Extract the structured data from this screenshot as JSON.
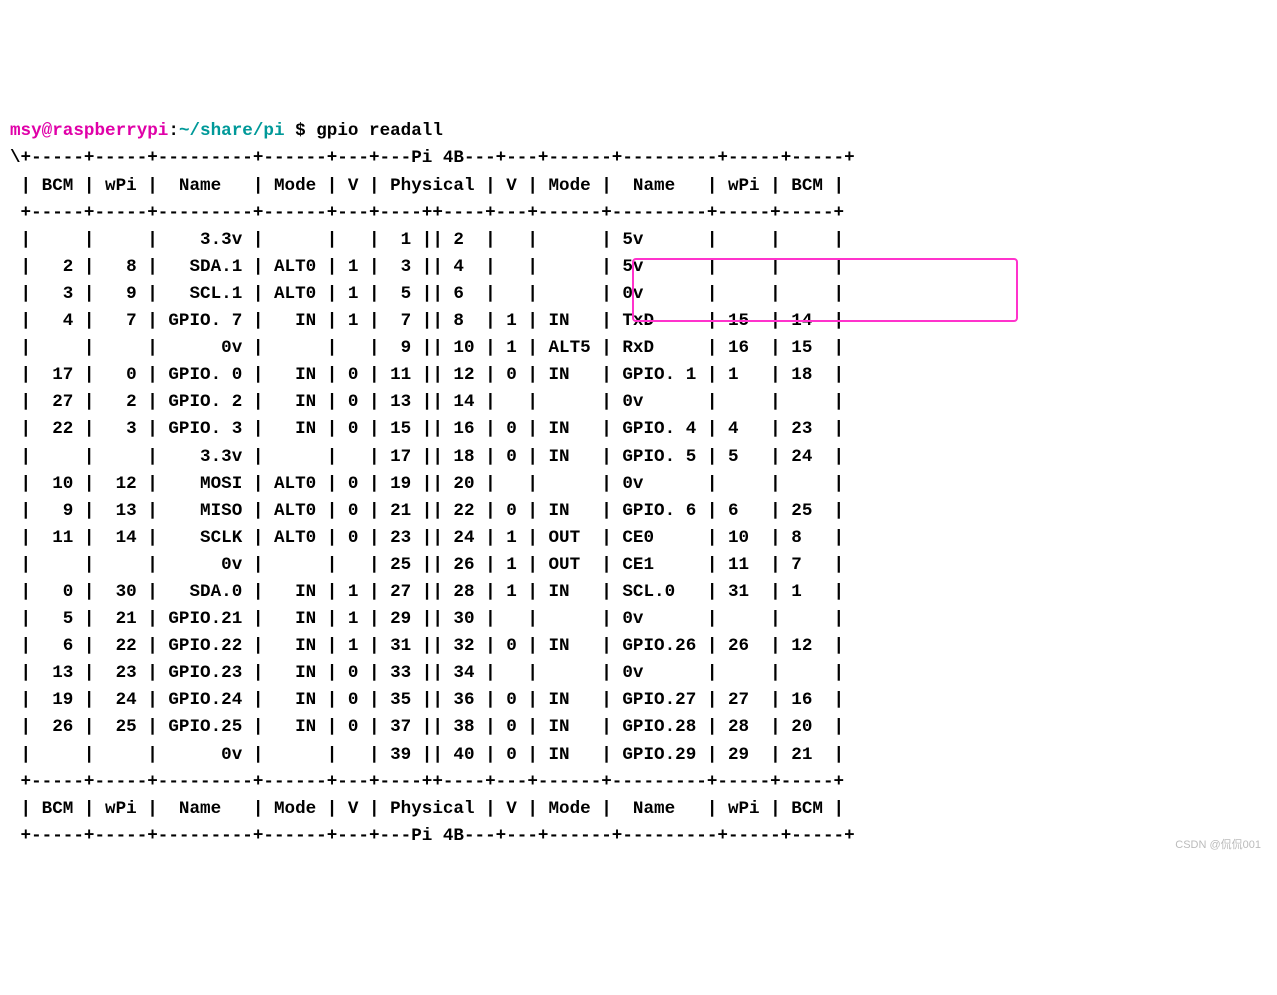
{
  "prompt": {
    "user": "msy@raspberrypi",
    "sep1": ":",
    "path": "~/share/pi",
    "dollar": " $ ",
    "cmd": "gpio readall"
  },
  "board": "Pi 4B",
  "headers": [
    "BCM",
    "wPi",
    "Name",
    "Mode",
    "V",
    "Physical",
    "V",
    "Mode",
    "Name",
    "wPi",
    "BCM"
  ],
  "hr_left": " +-----+-----+---------+------+---+---",
  "hr_right": "---+---+------+---------+-----+-----+",
  "rows": [
    {
      "l": {
        "bcm": "",
        "wpi": "",
        "name": "3.3v",
        "mode": "",
        "v": ""
      },
      "pl": "1",
      "pr": "2",
      "r": {
        "v": "",
        "mode": "",
        "name": "5v",
        "wpi": "",
        "bcm": ""
      }
    },
    {
      "l": {
        "bcm": "2",
        "wpi": "8",
        "name": "SDA.1",
        "mode": "ALT0",
        "v": "1"
      },
      "pl": "3",
      "pr": "4",
      "r": {
        "v": "",
        "mode": "",
        "name": "5v",
        "wpi": "",
        "bcm": ""
      }
    },
    {
      "l": {
        "bcm": "3",
        "wpi": "9",
        "name": "SCL.1",
        "mode": "ALT0",
        "v": "1"
      },
      "pl": "5",
      "pr": "6",
      "r": {
        "v": "",
        "mode": "",
        "name": "0v",
        "wpi": "",
        "bcm": ""
      }
    },
    {
      "l": {
        "bcm": "4",
        "wpi": "7",
        "name": "GPIO. 7",
        "mode": "IN",
        "v": "1"
      },
      "pl": "7",
      "pr": "8",
      "r": {
        "v": "1",
        "mode": "IN",
        "name": "TxD",
        "wpi": "15",
        "bcm": "14"
      }
    },
    {
      "l": {
        "bcm": "",
        "wpi": "",
        "name": "0v",
        "mode": "",
        "v": ""
      },
      "pl": "9",
      "pr": "10",
      "r": {
        "v": "1",
        "mode": "ALT5",
        "name": "RxD",
        "wpi": "16",
        "bcm": "15"
      }
    },
    {
      "l": {
        "bcm": "17",
        "wpi": "0",
        "name": "GPIO. 0",
        "mode": "IN",
        "v": "0"
      },
      "pl": "11",
      "pr": "12",
      "r": {
        "v": "0",
        "mode": "IN",
        "name": "GPIO. 1",
        "wpi": "1",
        "bcm": "18"
      }
    },
    {
      "l": {
        "bcm": "27",
        "wpi": "2",
        "name": "GPIO. 2",
        "mode": "IN",
        "v": "0"
      },
      "pl": "13",
      "pr": "14",
      "r": {
        "v": "",
        "mode": "",
        "name": "0v",
        "wpi": "",
        "bcm": ""
      }
    },
    {
      "l": {
        "bcm": "22",
        "wpi": "3",
        "name": "GPIO. 3",
        "mode": "IN",
        "v": "0"
      },
      "pl": "15",
      "pr": "16",
      "r": {
        "v": "0",
        "mode": "IN",
        "name": "GPIO. 4",
        "wpi": "4",
        "bcm": "23"
      }
    },
    {
      "l": {
        "bcm": "",
        "wpi": "",
        "name": "3.3v",
        "mode": "",
        "v": ""
      },
      "pl": "17",
      "pr": "18",
      "r": {
        "v": "0",
        "mode": "IN",
        "name": "GPIO. 5",
        "wpi": "5",
        "bcm": "24"
      }
    },
    {
      "l": {
        "bcm": "10",
        "wpi": "12",
        "name": "MOSI",
        "mode": "ALT0",
        "v": "0"
      },
      "pl": "19",
      "pr": "20",
      "r": {
        "v": "",
        "mode": "",
        "name": "0v",
        "wpi": "",
        "bcm": ""
      }
    },
    {
      "l": {
        "bcm": "9",
        "wpi": "13",
        "name": "MISO",
        "mode": "ALT0",
        "v": "0"
      },
      "pl": "21",
      "pr": "22",
      "r": {
        "v": "0",
        "mode": "IN",
        "name": "GPIO. 6",
        "wpi": "6",
        "bcm": "25"
      }
    },
    {
      "l": {
        "bcm": "11",
        "wpi": "14",
        "name": "SCLK",
        "mode": "ALT0",
        "v": "0"
      },
      "pl": "23",
      "pr": "24",
      "r": {
        "v": "1",
        "mode": "OUT",
        "name": "CE0",
        "wpi": "10",
        "bcm": "8"
      }
    },
    {
      "l": {
        "bcm": "",
        "wpi": "",
        "name": "0v",
        "mode": "",
        "v": ""
      },
      "pl": "25",
      "pr": "26",
      "r": {
        "v": "1",
        "mode": "OUT",
        "name": "CE1",
        "wpi": "11",
        "bcm": "7"
      }
    },
    {
      "l": {
        "bcm": "0",
        "wpi": "30",
        "name": "SDA.0",
        "mode": "IN",
        "v": "1"
      },
      "pl": "27",
      "pr": "28",
      "r": {
        "v": "1",
        "mode": "IN",
        "name": "SCL.0",
        "wpi": "31",
        "bcm": "1"
      }
    },
    {
      "l": {
        "bcm": "5",
        "wpi": "21",
        "name": "GPIO.21",
        "mode": "IN",
        "v": "1"
      },
      "pl": "29",
      "pr": "30",
      "r": {
        "v": "",
        "mode": "",
        "name": "0v",
        "wpi": "",
        "bcm": ""
      }
    },
    {
      "l": {
        "bcm": "6",
        "wpi": "22",
        "name": "GPIO.22",
        "mode": "IN",
        "v": "1"
      },
      "pl": "31",
      "pr": "32",
      "r": {
        "v": "0",
        "mode": "IN",
        "name": "GPIO.26",
        "wpi": "26",
        "bcm": "12"
      }
    },
    {
      "l": {
        "bcm": "13",
        "wpi": "23",
        "name": "GPIO.23",
        "mode": "IN",
        "v": "0"
      },
      "pl": "33",
      "pr": "34",
      "r": {
        "v": "",
        "mode": "",
        "name": "0v",
        "wpi": "",
        "bcm": ""
      }
    },
    {
      "l": {
        "bcm": "19",
        "wpi": "24",
        "name": "GPIO.24",
        "mode": "IN",
        "v": "0"
      },
      "pl": "35",
      "pr": "36",
      "r": {
        "v": "0",
        "mode": "IN",
        "name": "GPIO.27",
        "wpi": "27",
        "bcm": "16"
      }
    },
    {
      "l": {
        "bcm": "26",
        "wpi": "25",
        "name": "GPIO.25",
        "mode": "IN",
        "v": "0"
      },
      "pl": "37",
      "pr": "38",
      "r": {
        "v": "0",
        "mode": "IN",
        "name": "GPIO.28",
        "wpi": "28",
        "bcm": "20"
      }
    },
    {
      "l": {
        "bcm": "",
        "wpi": "",
        "name": "0v",
        "mode": "",
        "v": ""
      },
      "pl": "39",
      "pr": "40",
      "r": {
        "v": "0",
        "mode": "IN",
        "name": "GPIO.29",
        "wpi": "29",
        "bcm": "21"
      }
    }
  ],
  "watermark": "CSDN @侃侃001"
}
